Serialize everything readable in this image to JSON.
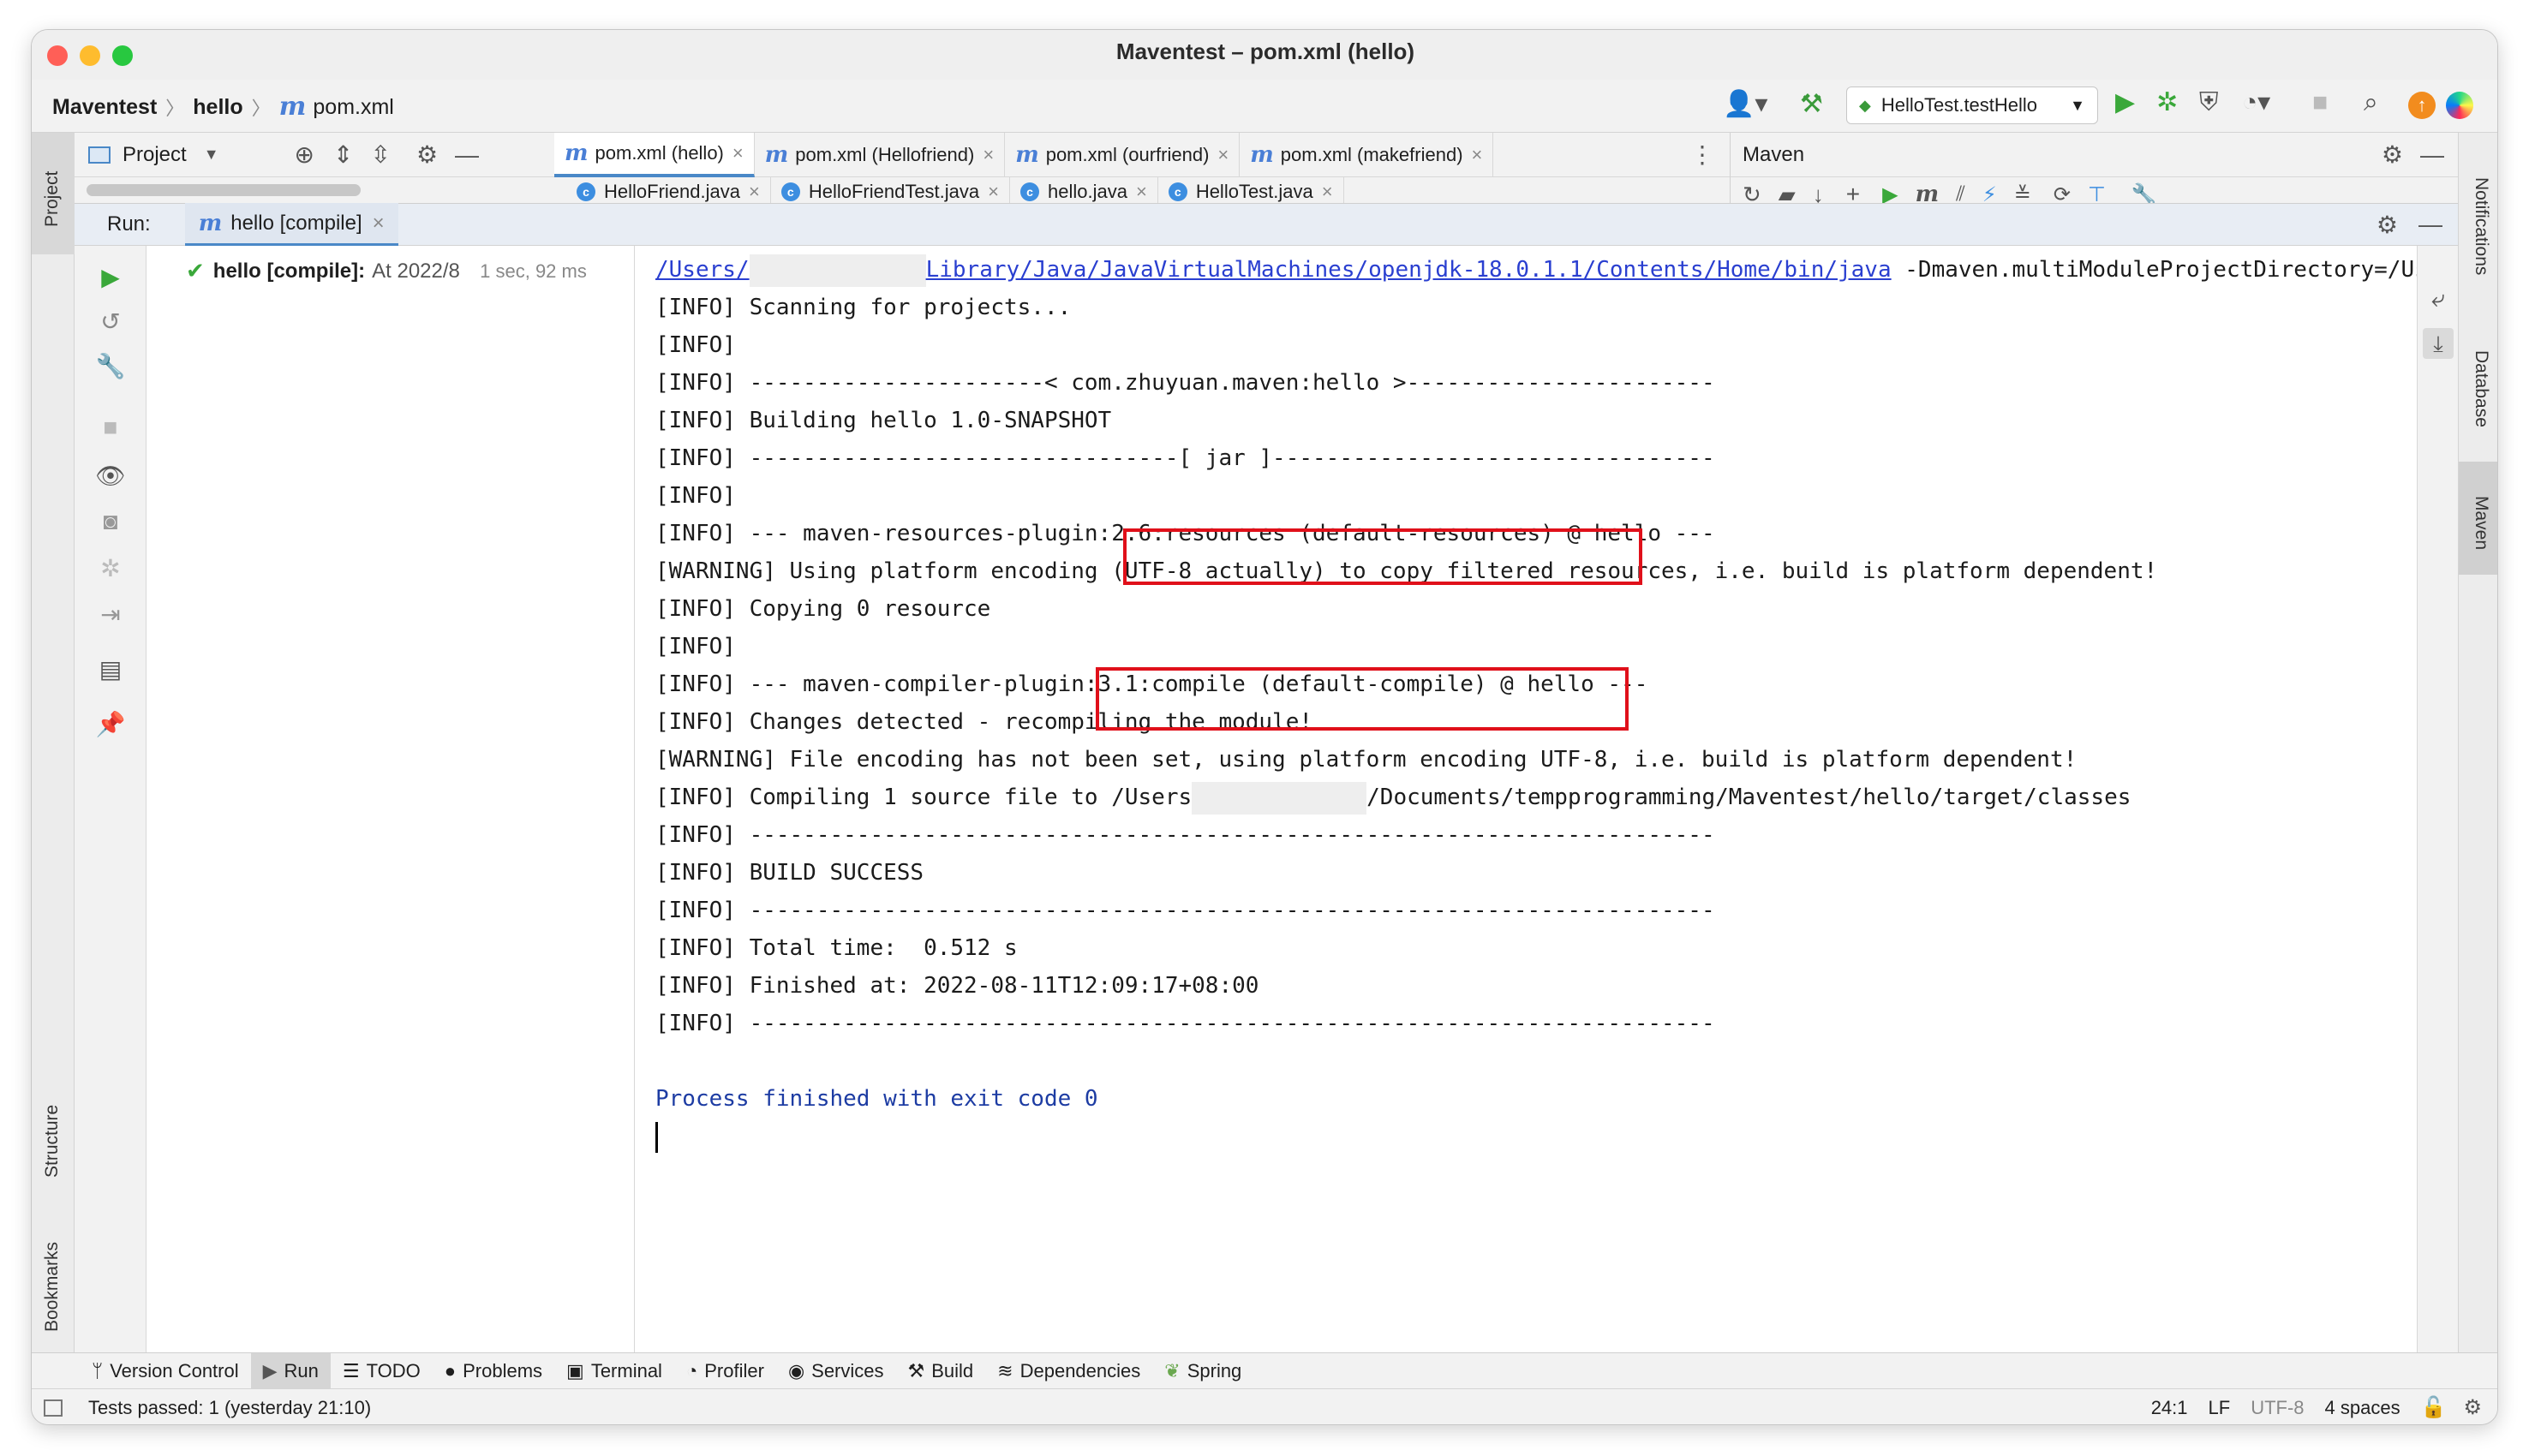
{
  "window": {
    "title": "Maventest – pom.xml (hello)"
  },
  "nav": {
    "breadcrumbs": [
      "Maventest",
      "hello",
      "pom.xml"
    ],
    "run_config": "HelloTest.testHello"
  },
  "project_panel": {
    "label": "Project"
  },
  "editor_tabs": [
    {
      "label": "pom.xml (hello)",
      "active": true
    },
    {
      "label": "pom.xml (Hellofriend)",
      "active": false
    },
    {
      "label": "pom.xml (ourfriend)",
      "active": false
    },
    {
      "label": "pom.xml (makefriend)",
      "active": false
    }
  ],
  "editor_tabs_row2": [
    "HelloFriend.java",
    "HelloFriendTest.java",
    "hello.java",
    "HelloTest.java"
  ],
  "maven_panel": {
    "label": "Maven"
  },
  "run_panel": {
    "label": "Run:",
    "tab": "hello [compile]",
    "tree_item": {
      "name": "hello [compile]:",
      "detail": "At 2022/8",
      "duration": "1 sec, 92 ms"
    }
  },
  "console": {
    "cmd_link_1": "/Users/",
    "cmd_link_2": "Library/Java/JavaVirtualMachines/openjdk-18.0.1.1/Contents/Home/bin/java",
    "cmd_rest": " -Dmaven.multiModuleProjectDirectory=/Us",
    "lines": [
      "[INFO] Scanning for projects...",
      "[INFO]",
      "[INFO] ----------------------< com.zhuyuan.maven:hello >-----------------------",
      "[INFO] Building hello 1.0-SNAPSHOT",
      "[INFO] --------------------------------[ jar ]---------------------------------",
      "[INFO]",
      "[INFO] --- maven-resources-plugin:2.6:resources (default-resources) @ hello ---",
      "[WARNING] Using platform encoding (UTF-8 actually) to copy filtered resources, i.e. build is platform dependent!",
      "[INFO] Copying 0 resource",
      "[INFO]",
      "[INFO] --- maven-compiler-plugin:3.1:compile (default-compile) @ hello ---",
      "[INFO] Changes detected - recompiling the module!",
      "[WARNING] File encoding has not been set, using platform encoding UTF-8, i.e. build is platform dependent!"
    ],
    "compile_line_a": "[INFO] Compiling 1 source file to /Users",
    "compile_line_b": "/Documents/tempprogramming/Maventest/hello/target/classes",
    "lines_after": [
      "[INFO] ------------------------------------------------------------------------",
      "[INFO] BUILD SUCCESS",
      "[INFO] ------------------------------------------------------------------------",
      "[INFO] Total time:  0.512 s",
      "[INFO] Finished at: 2022-08-11T12:09:17+08:00",
      "[INFO] ------------------------------------------------------------------------"
    ],
    "exit": "Process finished with exit code 0"
  },
  "side_labels": {
    "left": [
      "Project",
      "Structure",
      "Bookmarks"
    ],
    "right": [
      "Notifications",
      "Database",
      "Maven"
    ]
  },
  "bottom_tools": [
    "Version Control",
    "Run",
    "TODO",
    "Problems",
    "Terminal",
    "Profiler",
    "Services",
    "Build",
    "Dependencies",
    "Spring"
  ],
  "status": {
    "message": "Tests passed: 1 (yesterday 21:10)",
    "position": "24:1",
    "line_sep": "LF",
    "encoding": "UTF-8",
    "indent": "4 spaces"
  },
  "colors": {
    "accent": "#4a88c7",
    "highlight_box": "#e0101a",
    "link": "#2a3fd0",
    "run_green": "#3aa83a"
  }
}
